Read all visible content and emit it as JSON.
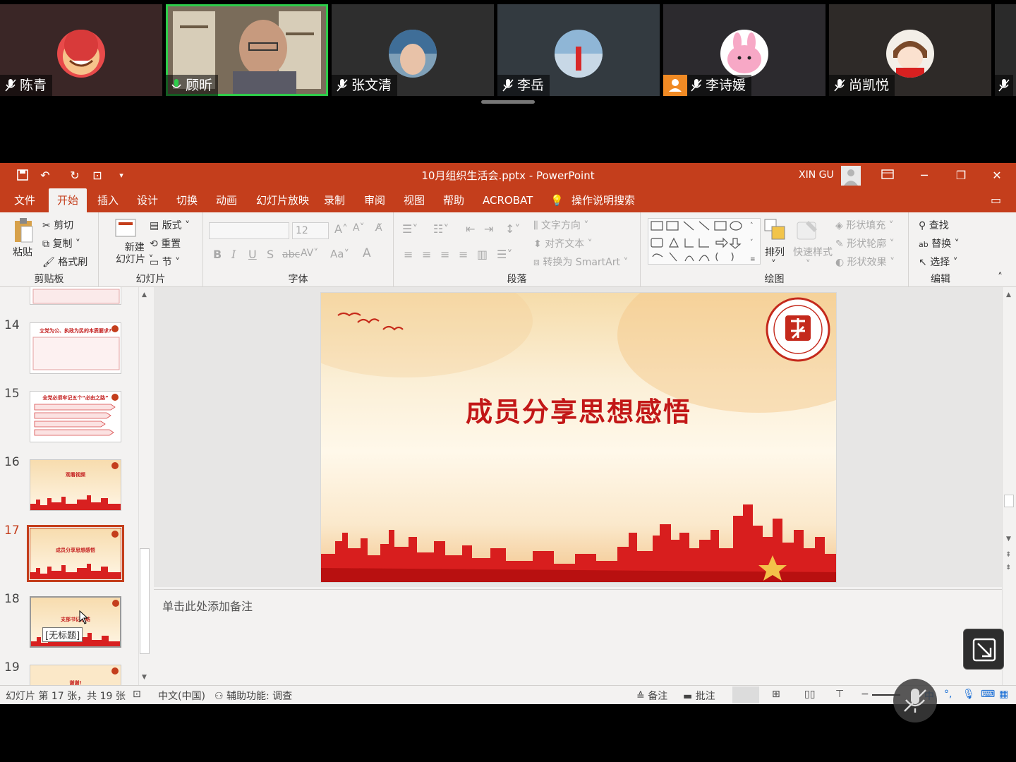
{
  "participants": [
    {
      "name": "陈青",
      "muted": true,
      "active": false,
      "avatar_color": "#e84a4a"
    },
    {
      "name": "顾昕",
      "muted": false,
      "active": true,
      "avatar_color": "#8a7a66"
    },
    {
      "name": "张文清",
      "muted": true,
      "active": false,
      "avatar_color": "#7fa0b8"
    },
    {
      "name": "李岳",
      "muted": true,
      "active": false,
      "avatar_color": "#8fb6d6"
    },
    {
      "name": "李诗媛",
      "muted": true,
      "active": false,
      "avatar_color": "#ffffff"
    },
    {
      "name": "尚凯悦",
      "muted": true,
      "active": false,
      "avatar_color": "#f3efe8"
    }
  ],
  "titlebar": {
    "title": "10月组织生活会.pptx  -  PowerPoint",
    "user": "XIN GU"
  },
  "menu": [
    "文件",
    "开始",
    "插入",
    "设计",
    "切换",
    "动画",
    "幻灯片放映",
    "录制",
    "审阅",
    "视图",
    "帮助",
    "ACROBAT",
    "操作说明搜索"
  ],
  "ribbon": {
    "clipboard": {
      "paste": "粘贴",
      "cut": "剪切",
      "copy": "复制",
      "format_painter": "格式刷",
      "label": "剪贴板"
    },
    "slides": {
      "new_slide": "新建\n幻灯片",
      "new_slide_1": "新建",
      "new_slide_2": "幻灯片",
      "layout": "版式",
      "reset": "重置",
      "section": "节",
      "label": "幻灯片"
    },
    "font": {
      "size": "12",
      "label": "字体",
      "case": "Aa"
    },
    "paragraph": {
      "text_direction": "文字方向",
      "align_text": "对齐文本",
      "smartart": "转换为 SmartArt",
      "label": "段落"
    },
    "drawing": {
      "arrange": "排列",
      "quick_styles": "快速样式",
      "shape_fill": "形状填充",
      "shape_outline": "形状轮廓",
      "shape_effects": "形状效果",
      "label": "绘图"
    },
    "editing": {
      "find": "查找",
      "replace": "替换",
      "select": "选择",
      "label": "编辑"
    }
  },
  "thumbnails": [
    {
      "num": "14",
      "title": "立党为公、执政为民的本质要求?",
      "current": false
    },
    {
      "num": "15",
      "title": "全党必须牢记五个“必由之路”",
      "current": false
    },
    {
      "num": "16",
      "title": "观看视频",
      "current": false
    },
    {
      "num": "17",
      "title": "成员分享思想感悟",
      "current": true
    },
    {
      "num": "18",
      "title": "支部书记总结",
      "current": false,
      "tooltip": "[无标题]"
    },
    {
      "num": "19",
      "title": "谢谢!",
      "current": false
    }
  ],
  "slide": {
    "title": "成员分享思想感悟"
  },
  "notes_placeholder": "单击此处添加备注",
  "status": {
    "slide_info": "幻灯片 第 17 张，共 19 张",
    "language": "中文(中国)",
    "accessibility": "辅助功能: 调查",
    "notes": "备注",
    "comments": "批注"
  },
  "colors": {
    "accent": "#c43e1c",
    "active_border": "#2ecc4a",
    "slide_title": "#c21717"
  }
}
